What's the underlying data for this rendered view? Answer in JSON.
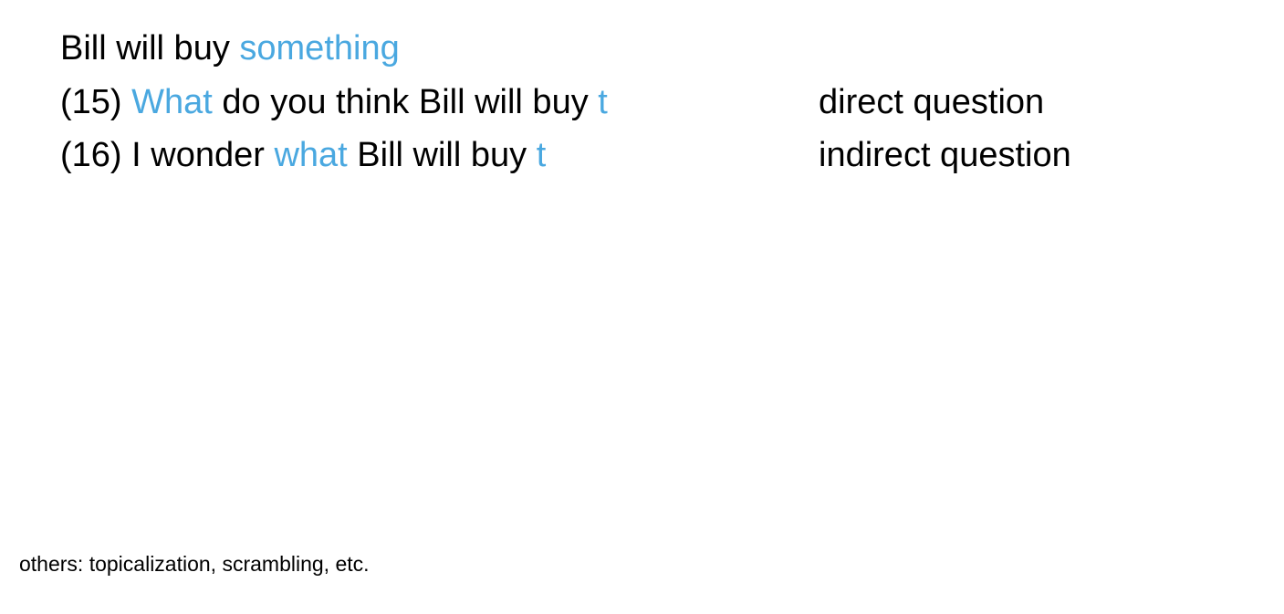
{
  "colors": {
    "text": "#000000",
    "highlight": "#4aa8e0",
    "background": "#ffffff"
  },
  "base_sentence": {
    "plain": "Bill will buy ",
    "highlight": "something"
  },
  "example_15": {
    "number": "(15) ",
    "wh_word": "What",
    "middle": " do you think Bill will buy ",
    "trace": "t",
    "label": "direct question"
  },
  "example_16": {
    "number": "(16) ",
    "before": "I wonder ",
    "wh_word": "what",
    "middle": " Bill will buy ",
    "trace": "t",
    "label": "indirect question"
  },
  "footnote": "others: topicalization, scrambling, etc."
}
